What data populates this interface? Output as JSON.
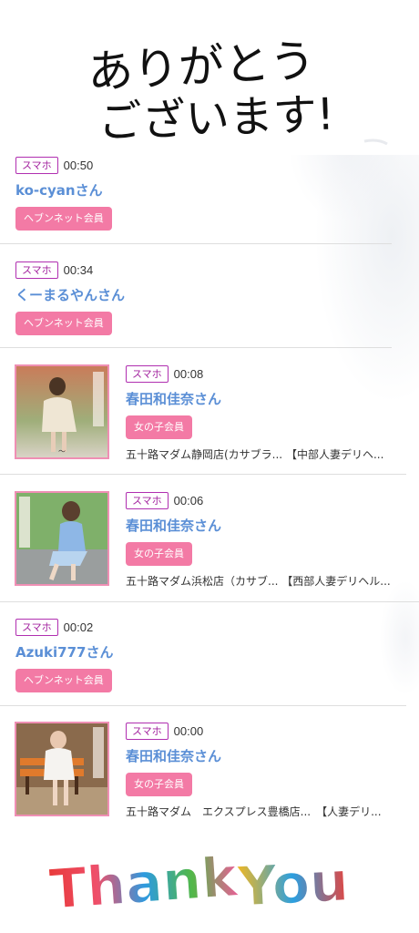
{
  "header": {
    "line1": "ありがとう",
    "line2": "ございます!"
  },
  "feed": [
    {
      "device": "スマホ",
      "time": "00:50",
      "name": "ko-cyanさん",
      "badge": "ヘブンネット会員",
      "shop": null
    },
    {
      "device": "スマホ",
      "time": "00:34",
      "name": "くーまるやんさん",
      "badge": "ヘブンネット会員",
      "shop": null
    },
    {
      "device": "スマホ",
      "time": "00:08",
      "name": "春田和佳奈さん",
      "badge": "女の子会員",
      "shop": "五十路マダム静岡店(カサブラ... 【中部人妻デリヘ..."
    },
    {
      "device": "スマホ",
      "time": "00:06",
      "name": "春田和佳奈さん",
      "badge": "女の子会員",
      "shop": "五十路マダム浜松店（カサブ... 【西部人妻デリヘル..."
    },
    {
      "device": "スマホ",
      "time": "00:02",
      "name": "Azuki777さん",
      "badge": "ヘブンネット会員",
      "shop": null
    },
    {
      "device": "スマホ",
      "time": "00:00",
      "name": "春田和佳奈さん",
      "badge": "女の子会員",
      "shop": "五十路マダム　エクスプレス豊橋店...　【人妻デリ..."
    }
  ],
  "footer": {
    "word1": "Thank",
    "word2": "You"
  },
  "colors": {
    "device_border": "#b02fb0",
    "name": "#5b8fd6",
    "badge_bg": "#f37aa5",
    "thumb_border": "#ef8fb4"
  }
}
